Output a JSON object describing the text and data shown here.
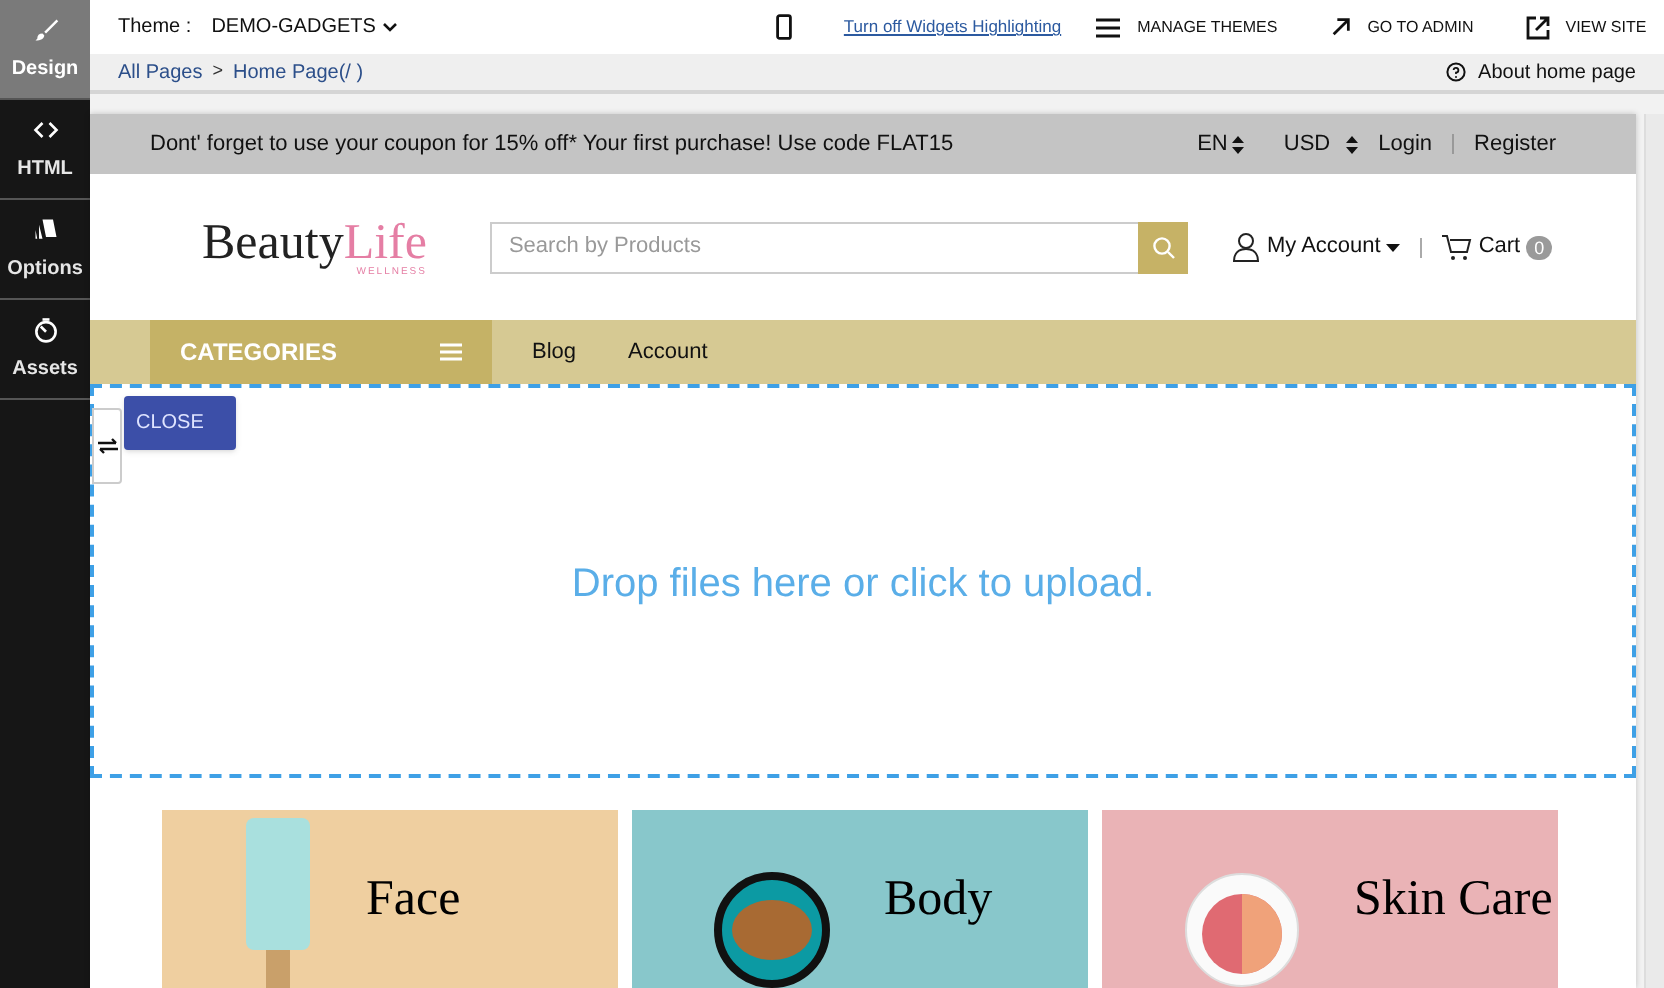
{
  "sidebar": {
    "items": [
      {
        "label": "Design",
        "selected": true
      },
      {
        "label": "HTML",
        "selected": false
      },
      {
        "label": "Options",
        "selected": false
      },
      {
        "label": "Assets",
        "selected": false
      }
    ]
  },
  "toolbar": {
    "theme_label": "Theme :",
    "theme_value": "DEMO-GADGETS",
    "highlight_link": "Turn off Widgets Highlighting",
    "actions": [
      "MANAGE THEMES",
      "GO TO ADMIN",
      "VIEW SITE"
    ]
  },
  "breadcrumb": {
    "items": [
      "All Pages",
      "Home Page(/ )"
    ],
    "separator": ">",
    "help": "About home page"
  },
  "promo_bar": {
    "text": "Dont' forget to use your coupon for 15% off* Your first purchase! Use code FLAT15",
    "language": "EN",
    "currency": "USD",
    "login": "Login",
    "register": "Register"
  },
  "header": {
    "logo_main": "Beauty",
    "logo_accent": "Life",
    "logo_sub": "WELLNESS",
    "search_placeholder": "Search by Products",
    "account": "My Account",
    "cart": "Cart",
    "cart_count": "0"
  },
  "nav": {
    "categories": "CATEGORIES",
    "links": [
      "Blog",
      "Account"
    ]
  },
  "dropzone": {
    "close": "CLOSE",
    "text": "Drop files here or click to upload."
  },
  "category_cards": [
    {
      "label": "Face",
      "color": "#efcfa0",
      "kind": "tube"
    },
    {
      "label": "Body",
      "color": "#88c7cb",
      "kind": "jar"
    },
    {
      "label": "Skin Care",
      "color": "#eab3b6",
      "kind": "compact"
    }
  ]
}
